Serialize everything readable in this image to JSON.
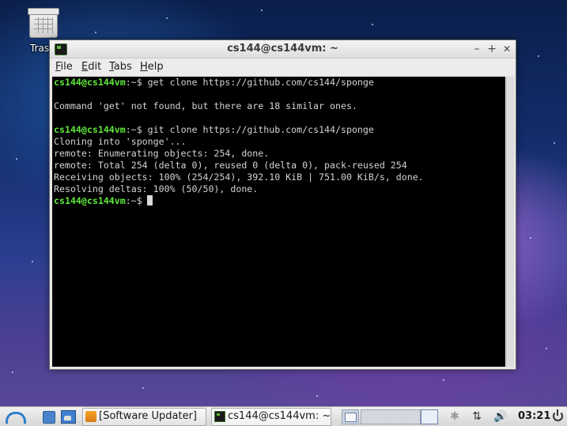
{
  "desktop": {
    "icons": [
      {
        "label": "Tras",
        "icon": "trash-icon"
      }
    ]
  },
  "window": {
    "title": "cs144@cs144vm: ~",
    "controls": {
      "minimize": "–",
      "maximize": "+",
      "close": "✕"
    },
    "menu": [
      "File",
      "Edit",
      "Tabs",
      "Help"
    ]
  },
  "terminal": {
    "prompt": "cs144@cs144vm",
    "path_suffix": ":~$",
    "lines": [
      {
        "type": "cmd",
        "text": " get clone https://github.com/cs144/sponge"
      },
      {
        "type": "out",
        "text": ""
      },
      {
        "type": "out",
        "text": "Command 'get' not found, but there are 18 similar ones."
      },
      {
        "type": "out",
        "text": ""
      },
      {
        "type": "cmd",
        "text": " git clone https://github.com/cs144/sponge"
      },
      {
        "type": "out",
        "text": "Cloning into 'sponge'..."
      },
      {
        "type": "out",
        "text": "remote: Enumerating objects: 254, done."
      },
      {
        "type": "out",
        "text": "remote: Total 254 (delta 0), reused 0 (delta 0), pack-reused 254"
      },
      {
        "type": "out",
        "text": "Receiving objects: 100% (254/254), 392.10 KiB | 751.00 KiB/s, done."
      },
      {
        "type": "out",
        "text": "Resolving deltas: 100% (50/50), done."
      },
      {
        "type": "cmd",
        "text": ""
      }
    ],
    "colors": {
      "background": "#000000",
      "prompt": "#5fe83b",
      "text": "#d3d3d3"
    }
  },
  "taskbar": {
    "tasks": [
      {
        "label": "[Software Updater]",
        "icon": "software-updater-icon"
      },
      {
        "label": "cs144@cs144vm: ~",
        "icon": "terminal-icon"
      }
    ],
    "clock": "03:21",
    "tray_icons": [
      "bluetooth-icon",
      "network-icon",
      "volume-icon"
    ]
  }
}
